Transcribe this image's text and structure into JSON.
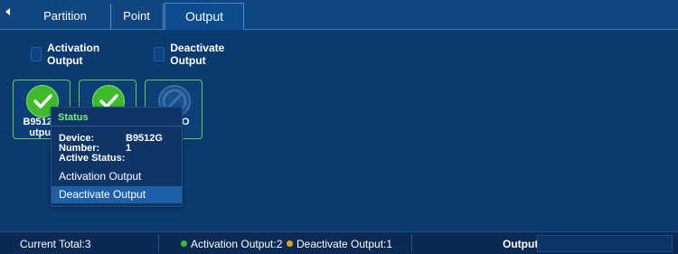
{
  "tabs": [
    {
      "label": "Partition",
      "active": false
    },
    {
      "label": "Point",
      "active": false
    },
    {
      "label": "Output",
      "active": true
    }
  ],
  "toolbar": {
    "activation_label": "Activation Output",
    "deactivate_label": "Deactivate Output"
  },
  "cards": [
    {
      "status": "active",
      "label_line1": "B9512G",
      "label_line2": "utput"
    },
    {
      "status": "active",
      "label_line1": "",
      "label_line2": ""
    },
    {
      "status": "inactive",
      "label_line1": "G_O",
      "label_line2": "3"
    }
  ],
  "popup": {
    "title": "Status",
    "device_key": "Device:",
    "device_value": "B9512G",
    "number_key": "Number:",
    "number_value": "1",
    "active_status_key": "Active Status:",
    "menu": [
      "Activation Output",
      "Deactivate Output"
    ]
  },
  "statusbar": {
    "current_total": "Current Total:3",
    "activation_count": "Activation Output:2",
    "deactivate_count": "Deactivate Output:1",
    "output_label": "Output",
    "output_value": ""
  },
  "colors": {
    "background": "#0b3a6e",
    "active_green": "#3ebb2a",
    "deactivated_orange": "#e0a020",
    "popup_title_green": "#7cf07c"
  }
}
